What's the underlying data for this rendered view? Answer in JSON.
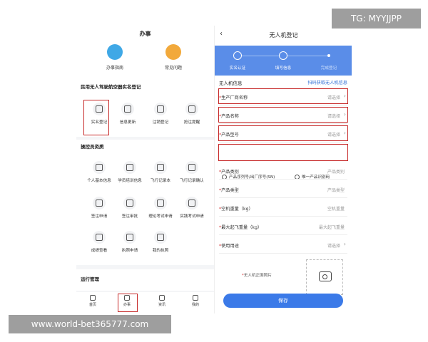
{
  "left": {
    "title": "办事",
    "top_items": [
      {
        "label": "办事指南",
        "icon": "guide-icon",
        "color": "#3fa8e6"
      },
      {
        "label": "常见问题",
        "icon": "question-icon",
        "color": "#f2a93b"
      }
    ],
    "sections": [
      {
        "title": "民用无人驾驶航空器实名登记",
        "items": [
          {
            "label": "实名登记",
            "icon": "user-scan-icon"
          },
          {
            "label": "信息更新",
            "icon": "calendar-icon"
          },
          {
            "label": "注销登记",
            "icon": "calendar-cancel-icon"
          },
          {
            "label": "抢注提醒",
            "icon": "alert-icon"
          }
        ]
      },
      {
        "title": "操控员资质",
        "items": [
          {
            "label": "个人基本信息",
            "icon": "person-icon"
          },
          {
            "label": "学员培训信息",
            "icon": "edit-icon"
          },
          {
            "label": "飞行记录本",
            "icon": "book-icon"
          },
          {
            "label": "飞行记录确认",
            "icon": "check-doc-icon"
          },
          {
            "label": "签注申请",
            "icon": "person-add-icon"
          },
          {
            "label": "签注审批",
            "icon": "person-check-icon"
          },
          {
            "label": "理论考试申请",
            "icon": "exam-icon"
          },
          {
            "label": "实践考试申请",
            "icon": "exam-icon"
          },
          {
            "label": "成绩查看",
            "icon": "grade-icon"
          },
          {
            "label": "执照申请",
            "icon": "license-icon"
          },
          {
            "label": "我的执照",
            "icon": "id-card-icon"
          }
        ]
      },
      {
        "title": "运行管理",
        "items": []
      }
    ],
    "tabs": [
      {
        "label": "首页",
        "icon": "home-icon"
      },
      {
        "label": "办事",
        "icon": "task-icon"
      },
      {
        "label": "资讯",
        "icon": "news-icon"
      },
      {
        "label": "我的",
        "icon": "profile-icon"
      }
    ]
  },
  "right": {
    "back": "‹",
    "title": "无人机登记",
    "steps": [
      "实名认证",
      "填写信息",
      "完成登记"
    ],
    "section_title": "无人机信息",
    "scan_label": "扫码获取无人机信息",
    "fields": [
      {
        "label": "生产厂商名称",
        "value": "请选择",
        "required": true,
        "chevron": true
      },
      {
        "label": "产品名称",
        "value": "请选择",
        "required": true,
        "chevron": true
      },
      {
        "label": "产品型号",
        "value": "请选择",
        "required": true,
        "chevron": true
      }
    ],
    "radio": [
      "产品序列号/出厂序号(SN)",
      "唯一产品识别码"
    ],
    "fields2": [
      {
        "label": "产品类别",
        "value": "产品类别",
        "required": true,
        "chevron": false
      },
      {
        "label": "产品类型",
        "value": "产品类型",
        "required": true,
        "chevron": false
      },
      {
        "label": "空机重量（kg）",
        "value": "空机重量",
        "required": true,
        "chevron": false
      },
      {
        "label": "最大起飞重量（kg）",
        "value": "最大起飞重量",
        "required": true,
        "chevron": false
      },
      {
        "label": "使用用途",
        "value": "请选择",
        "required": true,
        "chevron": true
      }
    ],
    "photo_label": "无人机正面照片",
    "save_label": "保存"
  },
  "watermarks": {
    "top_right": "TG: MYYJJPP",
    "bottom_left": "www.world-bet365777.com"
  },
  "colors": {
    "accent": "#3b7ae8",
    "highlight": "#c62828",
    "steps_bg": "#5a8de8"
  }
}
